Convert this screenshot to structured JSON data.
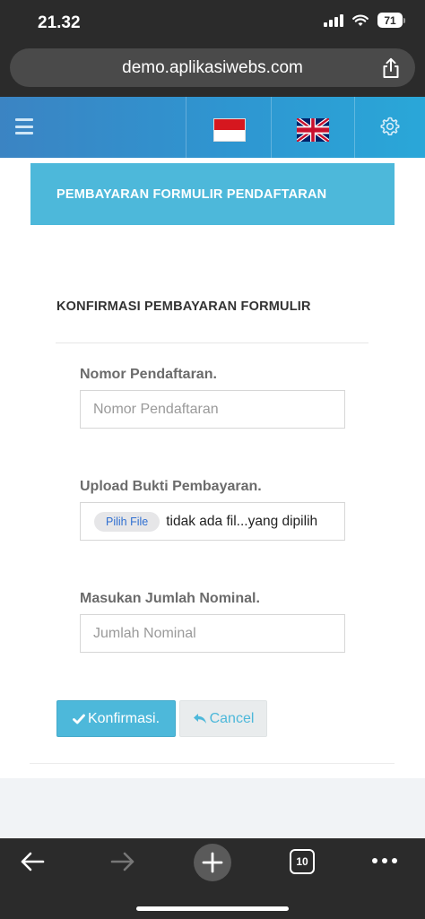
{
  "status": {
    "time": "21.32",
    "battery": "71"
  },
  "browser": {
    "url": "demo.aplikasiwebs.com",
    "tabs_count": "10"
  },
  "header": {
    "flags": [
      "indonesia-flag",
      "uk-flag"
    ],
    "colors": {
      "start": "#3b84c3",
      "end": "#2aa7d8"
    }
  },
  "page": {
    "panel_title": "PEMBAYARAN FORMULIR PENDAFTARAN",
    "section_title": "KONFIRMASI PEMBAYARAN FORMULIR"
  },
  "form": {
    "nomor_label": "Nomor Pendaftaran.",
    "nomor_placeholder": "Nomor Pendaftaran",
    "upload_label": "Upload Bukti Pembayaran.",
    "file_button": "Pilih File",
    "file_status": "tidak ada fil...yang dipilih",
    "nominal_label": "Masukan Jumlah Nominal.",
    "nominal_placeholder": "Jumlah Nominal"
  },
  "actions": {
    "confirm": "Konfirmasi.",
    "cancel": "Cancel"
  },
  "colors": {
    "accent": "#4db8da"
  }
}
